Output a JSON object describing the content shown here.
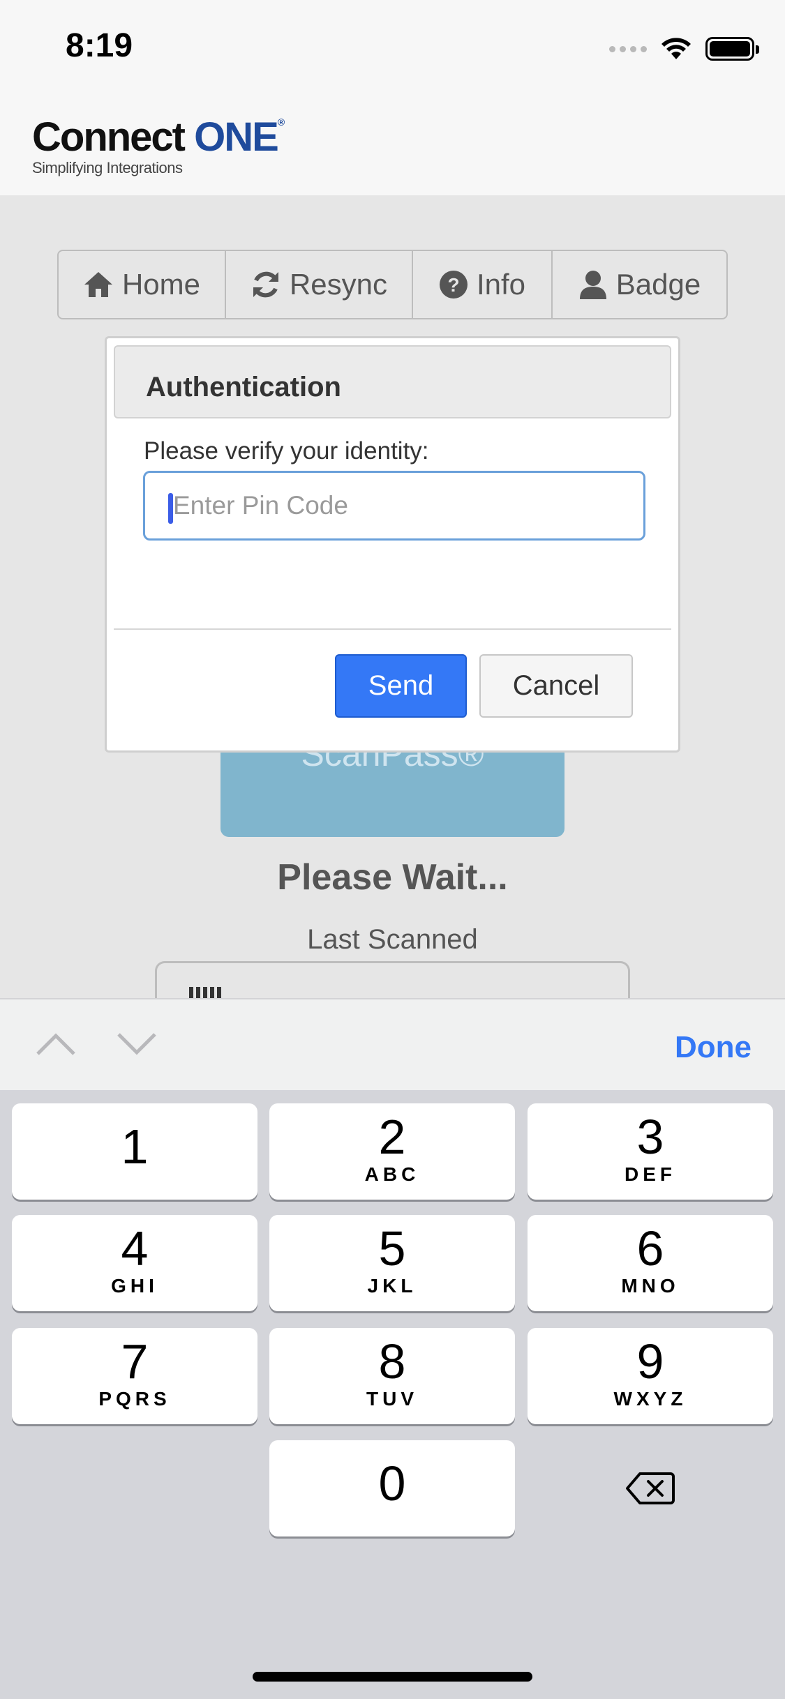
{
  "status_bar": {
    "time": "8:19"
  },
  "logo": {
    "name": "Connect",
    "name_accent": "ONE",
    "registered": "®",
    "tagline": "Simplifying Integrations"
  },
  "nav": {
    "items": [
      {
        "label": "Home",
        "icon": "home-icon"
      },
      {
        "label": "Resync",
        "icon": "refresh-icon"
      },
      {
        "label": "Info",
        "icon": "question-circle-icon"
      },
      {
        "label": "Badge",
        "icon": "user-icon"
      }
    ]
  },
  "background": {
    "scan_button_label": "ScanPass®",
    "status": "Please Wait...",
    "last_scanned_label": "Last Scanned"
  },
  "modal": {
    "title": "Authentication",
    "label": "Please verify your identity:",
    "input_value": "",
    "input_placeholder": "Enter Pin Code",
    "send_label": "Send",
    "cancel_label": "Cancel"
  },
  "keyboard": {
    "done_label": "Done",
    "keys": [
      {
        "num": "1",
        "letters": ""
      },
      {
        "num": "2",
        "letters": "ABC"
      },
      {
        "num": "3",
        "letters": "DEF"
      },
      {
        "num": "4",
        "letters": "GHI"
      },
      {
        "num": "5",
        "letters": "JKL"
      },
      {
        "num": "6",
        "letters": "MNO"
      },
      {
        "num": "7",
        "letters": "PQRS"
      },
      {
        "num": "8",
        "letters": "TUV"
      },
      {
        "num": "9",
        "letters": "WXYZ"
      },
      {
        "num": "0",
        "letters": ""
      }
    ]
  },
  "colors": {
    "accent": "#3478f6",
    "brand": "#1f4b9c",
    "scan_button": "#80b5cd"
  }
}
